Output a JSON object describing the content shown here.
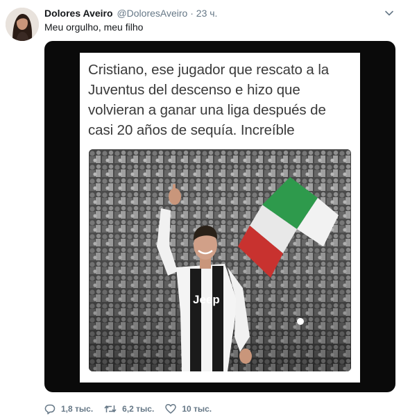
{
  "tweet": {
    "author": {
      "display_name": "Dolores Aveiro",
      "handle": "@DoloresAveiro",
      "avatar_icon": "avatar-photo"
    },
    "separator": "·",
    "time": "23 ч.",
    "text": "Meu orgulho, meu filho",
    "menu_icon": "chevron-down-icon",
    "media": {
      "caption": "Cristiano, ese jugador que rescato a la Juventus del descenso e hizo que volvieran a ganar una liga después de casi 20 años de sequía. Increíble",
      "photo_shirt_logo": "Jeep"
    },
    "actions": {
      "reply": {
        "icon": "reply-icon",
        "count": "1,8 тыс."
      },
      "retweet": {
        "icon": "retweet-icon",
        "count": "6,2 тыс."
      },
      "like": {
        "icon": "heart-icon",
        "count": "10 тыс."
      }
    }
  },
  "colors": {
    "text_primary": "#14171a",
    "text_secondary": "#657786",
    "media_background": "#0a0a0a",
    "card_background": "#ffffff"
  }
}
